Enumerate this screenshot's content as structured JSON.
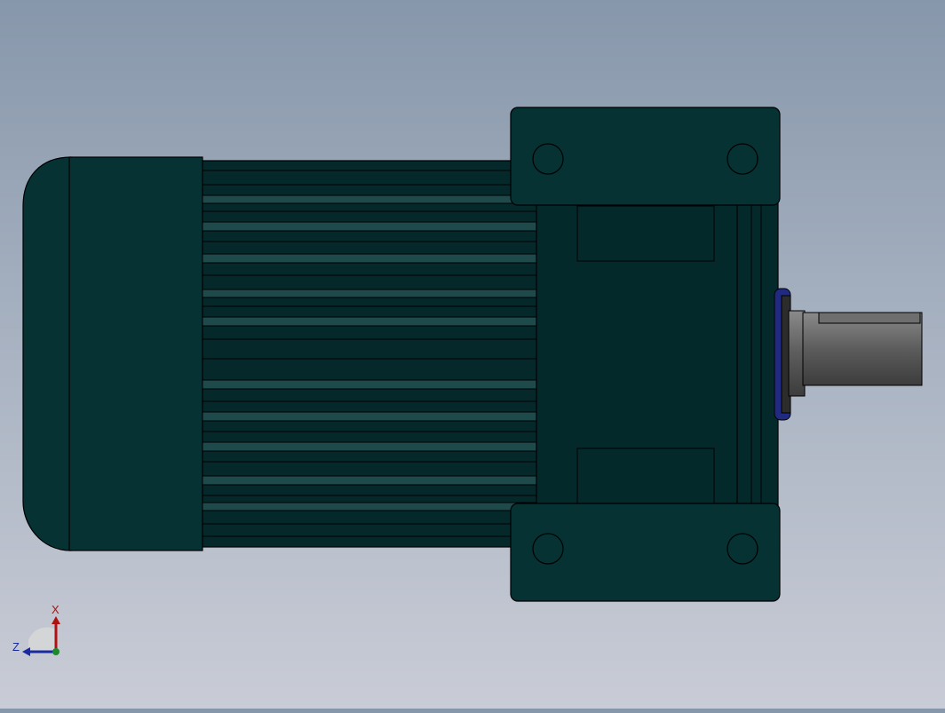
{
  "viewport": {
    "background_top": "#8797ab",
    "background_bottom": "#c9ccd6"
  },
  "model": {
    "body_color": "#04292b",
    "end_cap_color": "#063234",
    "fin_color": "#1f4a4b",
    "edge_color": "#000000",
    "shaft_color": "#5c5c5c",
    "seal_color": "#1f2a80"
  },
  "triad": {
    "x_label": "X",
    "z_label": "Z",
    "x_color": "#b01010",
    "z_color": "#1a2aa0",
    "origin_color": "#1a8a2a"
  }
}
